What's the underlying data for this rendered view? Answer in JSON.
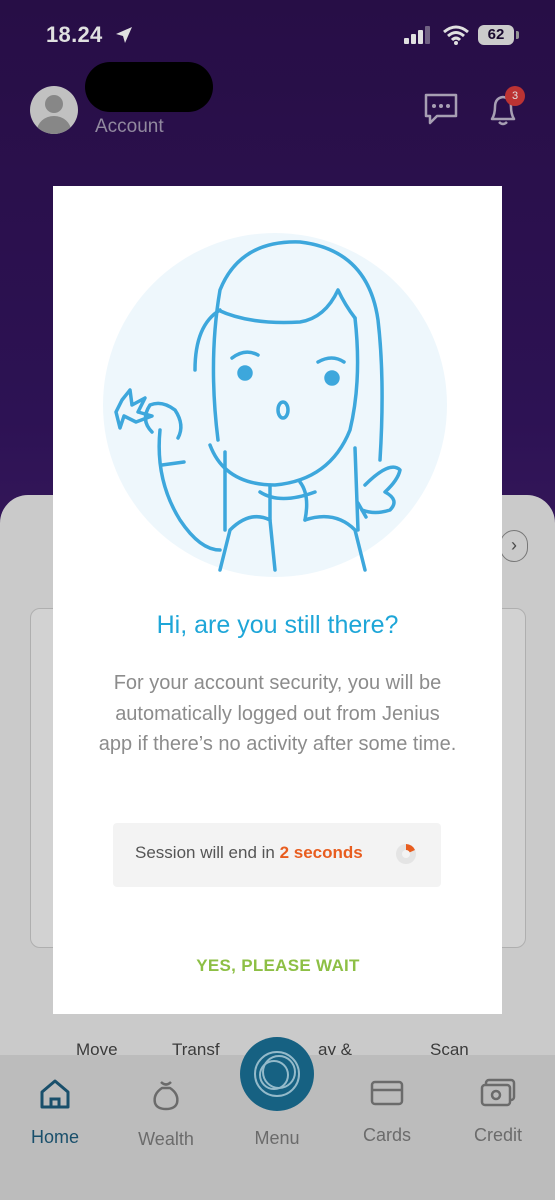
{
  "status_bar": {
    "time": "18.24",
    "battery": "62"
  },
  "header": {
    "account_label": "Account",
    "notification_count": "3"
  },
  "quick_actions": [
    "Move",
    "Transf",
    "ay &",
    "Scan"
  ],
  "bottom_nav": {
    "items": [
      {
        "label": "Home",
        "icon": "home-icon"
      },
      {
        "label": "Wealth",
        "icon": "money-bag-icon"
      },
      {
        "label": "Menu",
        "icon": "menu-rings-icon"
      },
      {
        "label": "Cards",
        "icon": "card-icon"
      },
      {
        "label": "Credit",
        "icon": "credit-icon"
      }
    ]
  },
  "modal": {
    "title": "Hi, are you still there?",
    "body": "For your account security, you will be automatically logged out from Jenius app if there’s no activity after some time.",
    "session_prefix": "Session will end in",
    "session_count": "2 seconds",
    "button_label": "YES, PLEASE WAIT"
  },
  "colors": {
    "accent_blue": "#1ea6d8",
    "countdown_orange": "#e85d1f",
    "button_green": "#8dbf45"
  }
}
